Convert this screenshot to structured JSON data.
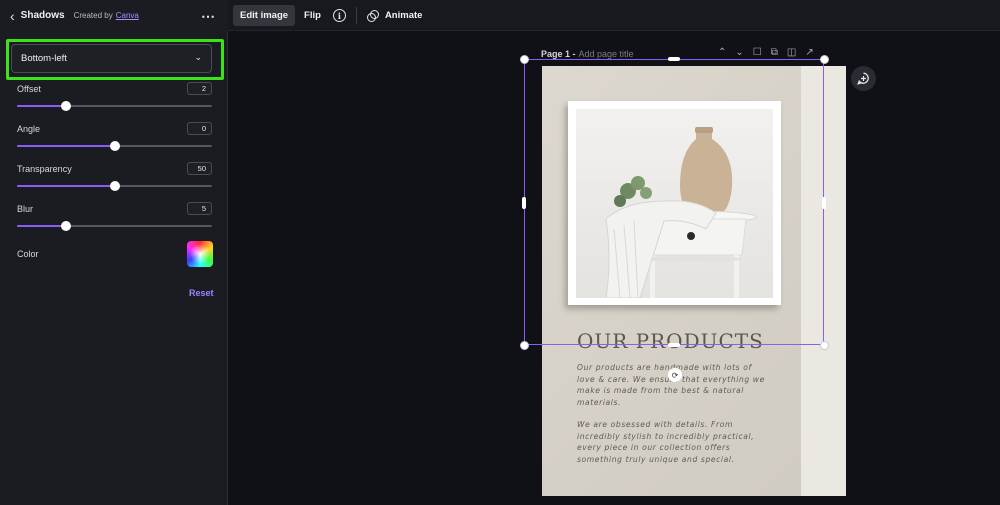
{
  "header": {
    "back_icon": "chevron-left-icon",
    "panel_title": "Shadows",
    "created_by": "Created by",
    "creator": "Canva",
    "more_icon": "more-horizontal-icon"
  },
  "toolbar": {
    "edit_image": "Edit image",
    "flip": "Flip",
    "info_icon": "info-icon",
    "animate": "Animate"
  },
  "shadow_panel": {
    "position": "Bottom-left",
    "offset": {
      "label": "Offset",
      "value": "2",
      "fraction": 0.25
    },
    "angle": {
      "label": "Angle",
      "value": "0",
      "fraction": 0.5
    },
    "transparency": {
      "label": "Transparency",
      "value": "50",
      "fraction": 0.5
    },
    "blur": {
      "label": "Blur",
      "value": "5",
      "fraction": 0.25
    },
    "color_label": "Color",
    "reset": "Reset",
    "accent_color": "#8b5cf6",
    "highlight_color": "#3ee21b"
  },
  "page": {
    "label": "Page 1 -",
    "title_placeholder": "Add page title",
    "headline": "OUR PRODUCTS",
    "paragraph1": "Our products are handmade with lots of love & care. We ensure that everything we make is made from the best & natural materials.",
    "paragraph2": "We are obsessed with details. From incredibly stylish to incredibly practical, every piece in our collection offers something truly unique and special."
  }
}
